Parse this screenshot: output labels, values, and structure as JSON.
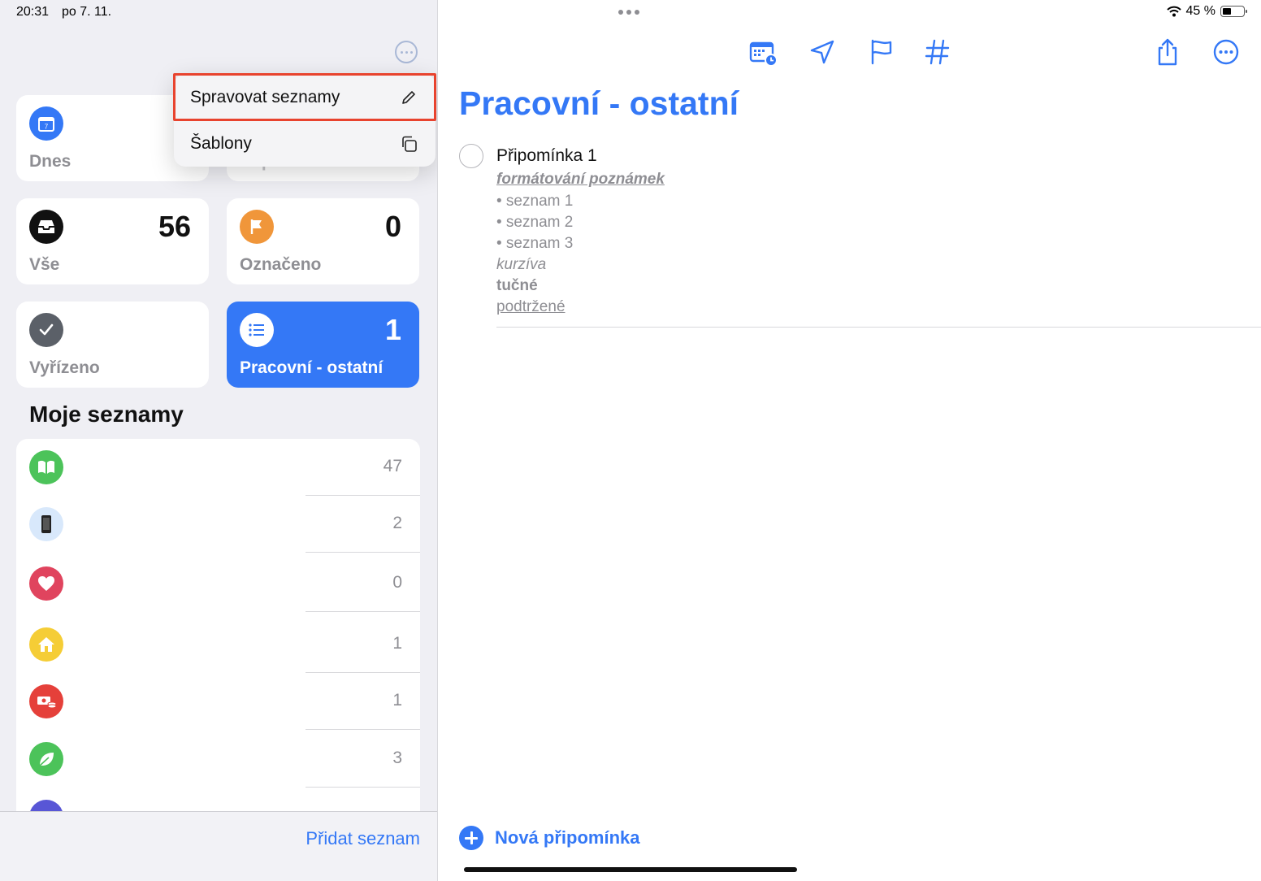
{
  "status": {
    "time": "20:31",
    "date": "po 7. 11.",
    "battery_text": "45 %",
    "battery_level": 0.45
  },
  "menu": {
    "items": [
      {
        "label": "Spravovat seznamy",
        "icon": "pencil-icon"
      },
      {
        "label": "Šablony",
        "icon": "copy-icon"
      }
    ]
  },
  "smart_lists": [
    {
      "label": "Dnes",
      "count": "",
      "icon": "calendar-icon",
      "color": "#3478f6"
    },
    {
      "label": "Naplánováno",
      "count": "",
      "icon": "calendar-icon",
      "color": "#e8432e"
    },
    {
      "label": "Vše",
      "count": "56",
      "icon": "tray-icon",
      "color": "#111111"
    },
    {
      "label": "Označeno",
      "count": "0",
      "icon": "flag-icon",
      "color": "#f0963a"
    },
    {
      "label": "Vyřízeno",
      "count": "",
      "icon": "checkmark-icon",
      "color": "#5b6068"
    },
    {
      "label": "Pracovní - ostatní",
      "count": "1",
      "icon": "list-icon",
      "color": "#ffffff"
    }
  ],
  "my_lists": {
    "title": "Moje seznamy",
    "items": [
      {
        "count": "47",
        "icon": "book-icon",
        "color": "#4cc35a"
      },
      {
        "count": "2",
        "icon": "phone-icon",
        "color": "#d8e8fb"
      },
      {
        "count": "0",
        "icon": "heart-icon",
        "color": "#e0445e"
      },
      {
        "count": "1",
        "icon": "house-icon",
        "color": "#f5cd36"
      },
      {
        "count": "1",
        "icon": "money-icon",
        "color": "#e5403a"
      },
      {
        "count": "3",
        "icon": "leaf-icon",
        "color": "#4cc35a"
      }
    ],
    "add_label": "Přidat seznam"
  },
  "main": {
    "title": "Pracovní - ostatní",
    "reminder": {
      "title": "Připomínka 1",
      "note_heading": "formátování poznámek",
      "bullets": [
        "• seznam 1",
        "• seznam 2",
        "• seznam 3"
      ],
      "italic": "kurzíva",
      "bold": "tučné",
      "underline": "podtržené"
    },
    "new_reminder_label": "Nová připomínka"
  },
  "colors": {
    "accent": "#3478f6",
    "highlight": "#e8432e"
  }
}
